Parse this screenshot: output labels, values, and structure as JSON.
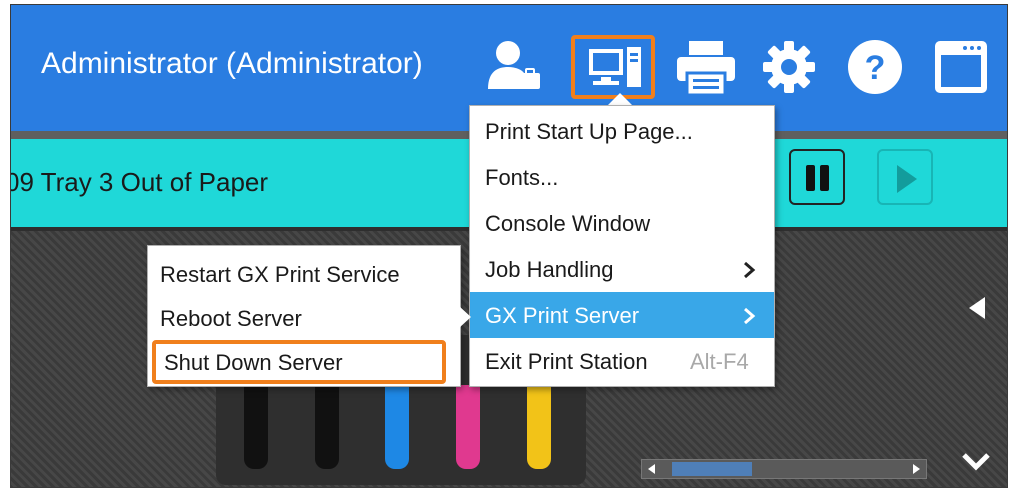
{
  "header": {
    "user_label": "Administrator (Administrator)",
    "icons": [
      "user-settings-icon",
      "console-icon",
      "printer-icon",
      "gear-icon",
      "help-icon",
      "window-icon"
    ]
  },
  "status": {
    "message": "09 Tray 3 Out of Paper"
  },
  "console_menu": {
    "items": [
      {
        "label": "Print Start Up Page..."
      },
      {
        "label": "Fonts..."
      },
      {
        "label": "Console Window"
      },
      {
        "label": "Job Handling",
        "has_submenu": true
      },
      {
        "label": "GX Print Server",
        "has_submenu": true,
        "active": true
      },
      {
        "label": "Exit Print Station",
        "shortcut": "Alt-F4"
      }
    ]
  },
  "server_submenu": {
    "items": [
      {
        "label": "Restart GX Print Service"
      },
      {
        "label": "Reboot Server"
      },
      {
        "label": "Shut Down Server",
        "highlighted": true
      }
    ]
  },
  "ink_levels": [
    {
      "name": "black",
      "color": "#111111"
    },
    {
      "name": "black",
      "color": "#111111"
    },
    {
      "name": "cyan",
      "color": "#1e88e5"
    },
    {
      "name": "magenta",
      "color": "#e0398f"
    },
    {
      "name": "yellow",
      "color": "#f2c318"
    }
  ],
  "colors": {
    "header_bg": "#2a7de1",
    "status_bg": "#1fd8d8",
    "menu_active": "#39a7e8",
    "highlight_border": "#f07f1c"
  }
}
